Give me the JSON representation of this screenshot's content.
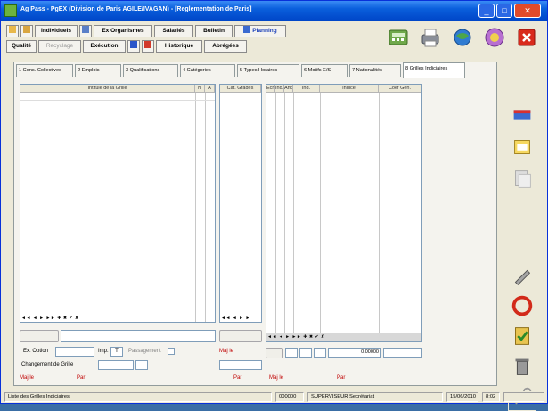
{
  "window": {
    "title": "Ag Pass - PgEX (Division de Paris AGILE/IVAGAN) - [Reglementation de Paris]",
    "controls": {
      "minimize": "_",
      "maximize": "□",
      "close": "✕"
    }
  },
  "toolbar": {
    "row1": [
      {
        "label": "Individuels",
        "disabled": false
      },
      {
        "label": "Ex Organismes",
        "disabled": false
      },
      {
        "label": "Salariés",
        "disabled": false
      },
      {
        "label": "Bulletin",
        "disabled": false
      },
      {
        "label": "Planning",
        "disabled": false
      }
    ],
    "row2": [
      {
        "label": "Qualité",
        "disabled": false
      },
      {
        "label": "Recyclage",
        "disabled": true
      },
      {
        "label": "Exécution",
        "disabled": false
      },
      {
        "label": "Historique",
        "disabled": false
      },
      {
        "label": "Abrégées",
        "disabled": false
      }
    ]
  },
  "tabs": [
    {
      "label": "1 Cons. Collectives",
      "active": false
    },
    {
      "label": "2 Emplois",
      "active": false
    },
    {
      "label": "3 Qualifications",
      "active": false
    },
    {
      "label": "4 Catégories",
      "active": false
    },
    {
      "label": "5 Types Horaires",
      "active": false
    },
    {
      "label": "6 Motifs E/S",
      "active": false
    },
    {
      "label": "7 Nationalités",
      "active": false
    },
    {
      "label": "8 Grilles Indiciaires",
      "active": true
    }
  ],
  "left_panel": {
    "headers": [
      "Intitulé de la Grille",
      "N",
      "A"
    ],
    "nav": "◄◄ ◄ ► ►►  ✚ ✖ ✔ ✘",
    "form": {
      "ex_option_label": "Ex. Option",
      "imp_label": "Imp.",
      "imp_value": "T",
      "passage_label": "Passagement",
      "changement_label": "Changement de Grille",
      "maj_le_label": "Maj le",
      "par_label": "Par"
    }
  },
  "middle_panel": {
    "headers": [
      "Cat. Grades"
    ],
    "nav": "◄◄ ◄ ► ►",
    "maj_le_label": "Maj le",
    "par_label": "Par"
  },
  "right_panel": {
    "headers": [
      "Ech",
      "Ind.",
      "Anc.",
      "Ind.",
      "Indice",
      "Coef Gén."
    ],
    "nav": "◄◄ ◄ ► ►►  ✚ ✖ ✔ ✘",
    "coef_value": "0.00000",
    "maj_le_label": "Maj le",
    "par_label": "Par"
  },
  "status": {
    "message": "Liste des Grilles Indiciaires",
    "code": "000000",
    "user": "SUPERVISEUR Secrétariat",
    "date": "15/06/2010",
    "time": "8:02"
  },
  "colors": {
    "titlebar": "#0a5fdc",
    "window": "#ece9d8",
    "label_red": "#c00000"
  }
}
